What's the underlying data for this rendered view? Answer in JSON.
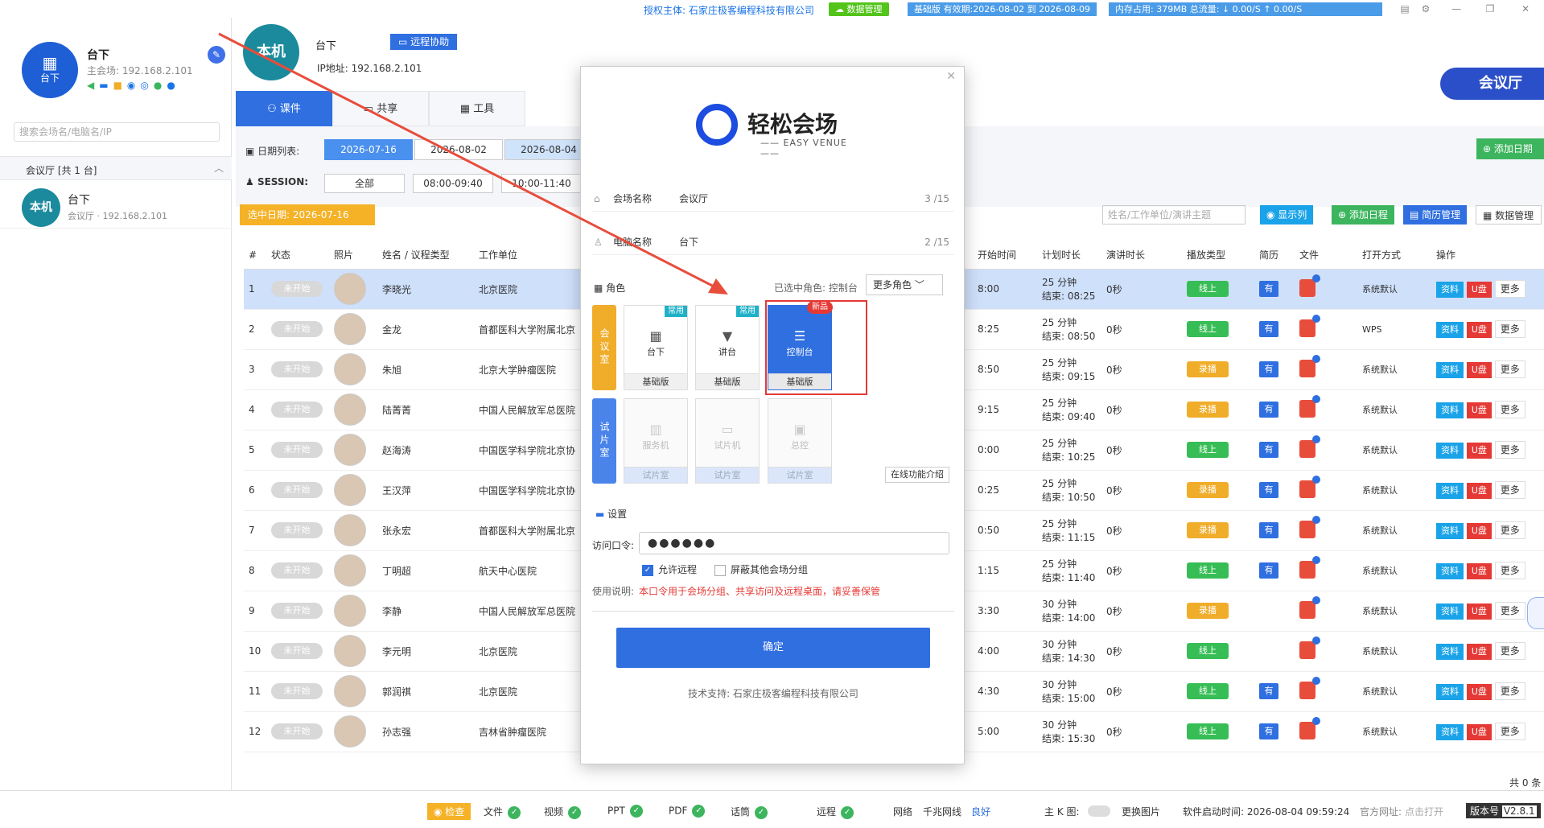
{
  "topbar": {
    "license": "授权主体: 石家庄极客编程科技有限公司",
    "data_mgmt": "数据管理",
    "version_info": "基础版 有效期:2026-08-02 到 2026-08-09",
    "memory": "内存占用: 379MB  总流量: ↓ 0.00/S   ↑ 0.00/S"
  },
  "sidebar": {
    "self_name": "台下",
    "self_icon_label": "台下",
    "self_host": "主会场: 192.168.2.101",
    "search_placeholder": "搜索会场名/电脑名/IP",
    "group_label": "会议厅   [共 1 台]",
    "item_avatar": "本机",
    "item_name": "台下",
    "item_sub": "会议厅 · 192.168.2.101"
  },
  "header": {
    "avatar": "本机",
    "name": "台下",
    "remote_btn": "远程协助",
    "ip": "IP地址: 192.168.2.101",
    "venue": "会议厅"
  },
  "tabs": [
    {
      "label": "课件"
    },
    {
      "label": "共享"
    },
    {
      "label": "工具"
    }
  ],
  "filters": {
    "date_label": "日期列表:",
    "dates": [
      "2026-07-16",
      "2026-08-02",
      "2026-08-04"
    ],
    "session_label": "SESSION:",
    "sessions": [
      "全部",
      "08:00-09:40",
      "10:00-11:40"
    ],
    "add_date": "添加日期",
    "selected_date": "选中日期: 2026-07-16",
    "right_search_placeholder": "姓名/工作单位/演讲主题",
    "show_cols": "显示列",
    "add_schedule": "添加日程",
    "cv_mgmt": "简历管理",
    "data_mgmt": "数据管理"
  },
  "table": {
    "headers": [
      "#",
      "状态",
      "照片",
      "姓名 / 议程类型",
      "工作单位",
      "开始时间",
      "计划时长",
      "演讲时长",
      "播放类型",
      "简历",
      "文件",
      "打开方式",
      "操作"
    ],
    "rows": [
      {
        "n": "1",
        "status": "未开始",
        "name": "李晓光",
        "org": "北京医院",
        "start": "8:00",
        "dur": "25 分钟",
        "end": "结束: 08:25",
        "speech": "0秒",
        "type": "线上",
        "type_color": "green",
        "cv": "有",
        "open": "系统默认"
      },
      {
        "n": "2",
        "status": "未开始",
        "name": "金龙",
        "org": "首都医科大学附属北京",
        "start": "8:25",
        "dur": "25 分钟",
        "end": "结束: 08:50",
        "speech": "0秒",
        "type": "线上",
        "type_color": "green",
        "cv": "有",
        "open": "WPS"
      },
      {
        "n": "3",
        "status": "未开始",
        "name": "朱旭",
        "org": "北京大学肿瘤医院",
        "start": "8:50",
        "dur": "25 分钟",
        "end": "结束: 09:15",
        "speech": "0秒",
        "type": "录播",
        "type_color": "orange",
        "cv": "有",
        "open": "系统默认"
      },
      {
        "n": "4",
        "status": "未开始",
        "name": "陆菁菁",
        "org": "中国人民解放军总医院",
        "start": "9:15",
        "dur": "25 分钟",
        "end": "结束: 09:40",
        "speech": "0秒",
        "type": "录播",
        "type_color": "orange",
        "cv": "有",
        "open": "系统默认"
      },
      {
        "n": "5",
        "status": "未开始",
        "name": "赵海涛",
        "org": "中国医学科学院北京协",
        "start": "0:00",
        "dur": "25 分钟",
        "end": "结束: 10:25",
        "speech": "0秒",
        "type": "线上",
        "type_color": "green",
        "cv": "有",
        "open": "系统默认"
      },
      {
        "n": "6",
        "status": "未开始",
        "name": "王汉萍",
        "org": "中国医学科学院北京协",
        "start": "0:25",
        "dur": "25 分钟",
        "end": "结束: 10:50",
        "speech": "0秒",
        "type": "录播",
        "type_color": "orange",
        "cv": "有",
        "open": "系统默认"
      },
      {
        "n": "7",
        "status": "未开始",
        "name": "张永宏",
        "org": "首都医科大学附属北京",
        "start": "0:50",
        "dur": "25 分钟",
        "end": "结束: 11:15",
        "speech": "0秒",
        "type": "录播",
        "type_color": "orange",
        "cv": "有",
        "open": "系统默认"
      },
      {
        "n": "8",
        "status": "未开始",
        "name": "丁明超",
        "org": "航天中心医院",
        "start": "1:15",
        "dur": "25 分钟",
        "end": "结束: 11:40",
        "speech": "0秒",
        "type": "线上",
        "type_color": "green",
        "cv": "有",
        "open": "系统默认"
      },
      {
        "n": "9",
        "status": "未开始",
        "name": "李静",
        "org": "中国人民解放军总医院",
        "start": "3:30",
        "dur": "30 分钟",
        "end": "结束: 14:00",
        "speech": "0秒",
        "type": "录播",
        "type_color": "orange",
        "cv": "",
        "open": "系统默认"
      },
      {
        "n": "10",
        "status": "未开始",
        "name": "李元明",
        "org": "北京医院",
        "start": "4:00",
        "dur": "30 分钟",
        "end": "结束: 14:30",
        "speech": "0秒",
        "type": "线上",
        "type_color": "green",
        "cv": "",
        "open": "系统默认"
      },
      {
        "n": "11",
        "status": "未开始",
        "name": "郭润祺",
        "org": "北京医院",
        "start": "4:30",
        "dur": "30 分钟",
        "end": "结束: 15:00",
        "speech": "0秒",
        "type": "线上",
        "type_color": "green",
        "cv": "有",
        "open": "系统默认"
      },
      {
        "n": "12",
        "status": "未开始",
        "name": "孙志强",
        "org": "吉林省肿瘤医院",
        "start": "5:00",
        "dur": "30 分钟",
        "end": "结束: 15:30",
        "speech": "0秒",
        "type": "线上",
        "type_color": "green",
        "cv": "有",
        "open": "系统默认"
      }
    ],
    "op_info": "资料",
    "op_u": "U盘",
    "op_more": "更多",
    "total": "共 0 条"
  },
  "footer": {
    "check": "检查",
    "file": "文件",
    "video": "视频",
    "ppt": "PPT",
    "pdf": "PDF",
    "speech": "话筒",
    "remote": "远程",
    "network": "网络",
    "network_type": "千兆网线",
    "network_status": "良好",
    "kmap": "主 K 图:",
    "change_image": "更换图片",
    "startup_time": "软件启动时间: 2026-08-04 09:59:24",
    "site": "官方网址:",
    "open_link": "点击打开",
    "version_label": "版本号",
    "version": "V2.8.1"
  },
  "modal": {
    "logo_title": "轻松会场",
    "logo_sub": "—— EASY VENUE ——",
    "venue_label": "会场名称",
    "venue_value": "会议厅",
    "venue_count": "3 /15",
    "pc_label": "电脑名称",
    "pc_value": "台下",
    "pc_count": "2 /15",
    "role_label": "角色",
    "role_selected": "已选中角色: 控制台",
    "role_more": "更多角色",
    "meeting_room_tab": "会议室",
    "preview_room_tab": "试片室",
    "cards_meeting": [
      {
        "label": "台下",
        "bottom": "基础版",
        "tag": "常用"
      },
      {
        "label": "讲台",
        "bottom": "基础版",
        "tag": "常用"
      },
      {
        "label": "控制台",
        "bottom": "基础版",
        "tag": "新品"
      }
    ],
    "cards_preview": [
      {
        "label": "服务机",
        "bottom": "试片室"
      },
      {
        "label": "试片机",
        "bottom": "试片室"
      },
      {
        "label": "总控",
        "bottom": "试片室"
      }
    ],
    "intro": "在线功能介绍",
    "settings": "设置",
    "password_label": "访问口令:",
    "password_value": "●●●●●●",
    "allow_remote": "允许远程",
    "block_groups": "屏蔽其他会场分组",
    "note_label": "使用说明:",
    "note_warn": "本口令用于会场分组、共享访问及远程桌面，请妥善保管",
    "confirm": "确定",
    "support": "技术支持: 石家庄极客编程科技有限公司"
  },
  "colors": {
    "primary": "#2f6fe0",
    "green": "#37bd55",
    "orange": "#f0ad2a",
    "red": "#e53935",
    "highlight_row": "#cfe0fb"
  }
}
